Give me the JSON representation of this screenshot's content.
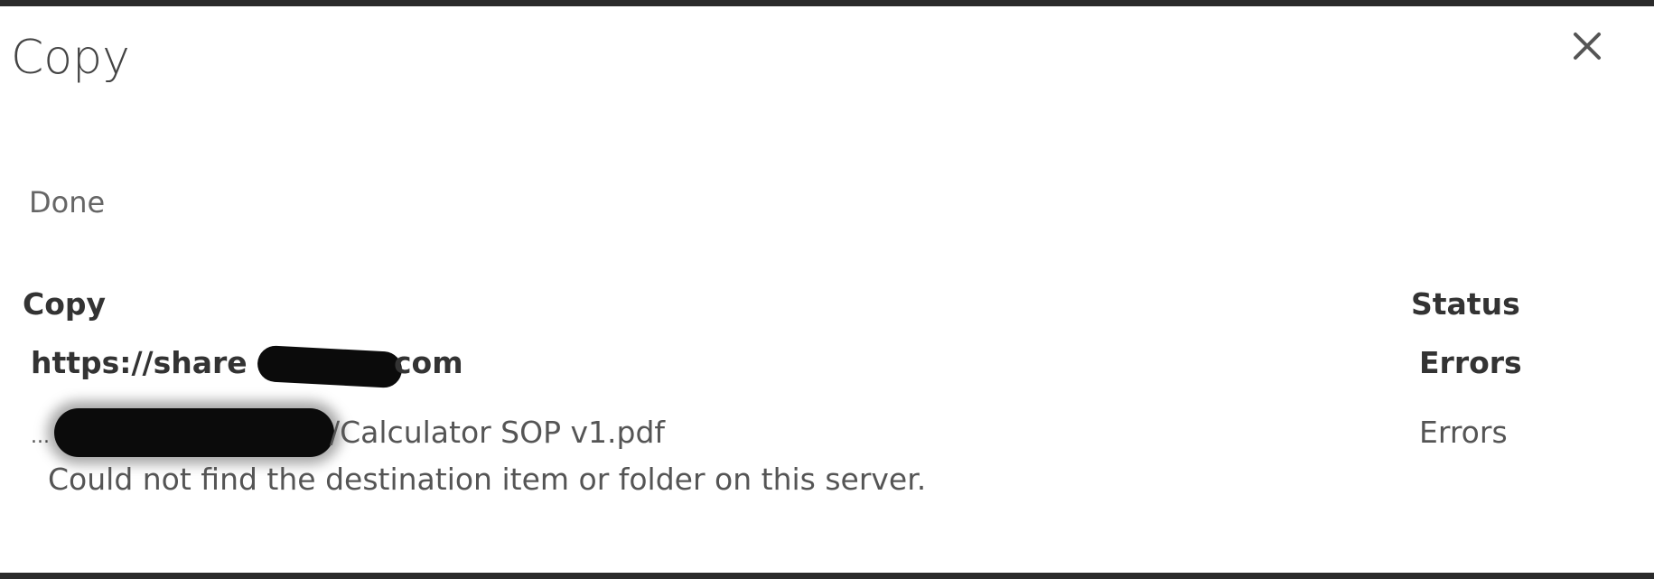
{
  "dialog": {
    "title": "Copy",
    "state": "Done",
    "close_icon": "close-icon"
  },
  "columns": {
    "copy": "Copy",
    "status": "Status"
  },
  "site_row": {
    "prefix": "https://share",
    "suffix": "com",
    "status": "Errors"
  },
  "file_row": {
    "prefix": "...",
    "name": "/Calculator SOP v1.pdf",
    "status": "Errors",
    "message": "Could not find the destination item or folder on this server."
  }
}
